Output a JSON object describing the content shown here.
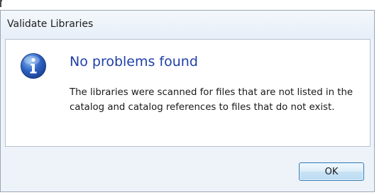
{
  "dialog": {
    "title": "Validate Libraries",
    "icon": "info-icon",
    "heading": "No problems found",
    "message": "The libraries were scanned for files that are not listed in the catalog and catalog references to files that do not exist.",
    "ok_label": "OK"
  },
  "colors": {
    "heading": "#1f3fa8",
    "icon_blue": "#2d62c4",
    "button_border": "#3c7fb1"
  }
}
